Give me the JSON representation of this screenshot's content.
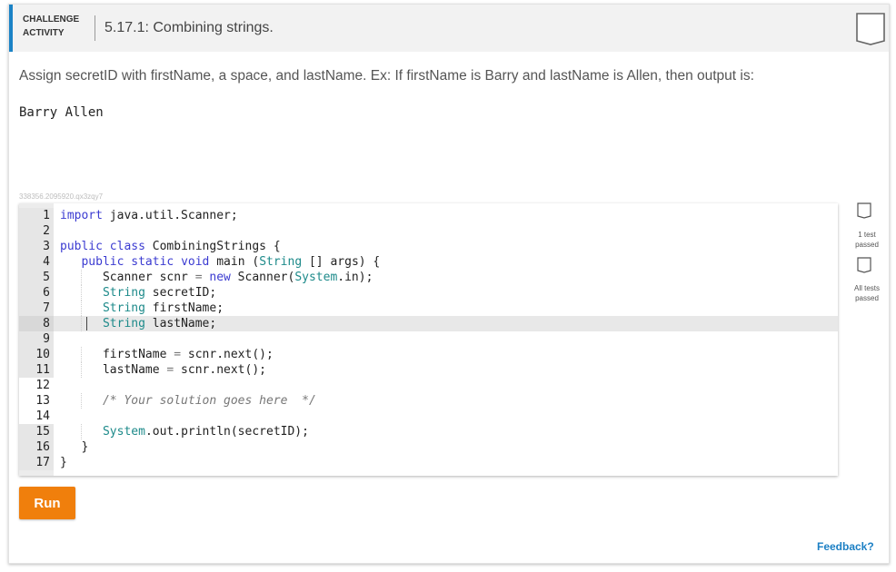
{
  "header": {
    "badge_line1": "CHALLENGE",
    "badge_line2": "ACTIVITY",
    "title": "5.17.1: Combining strings.",
    "accent_color": "#1b83c6"
  },
  "instructions": "Assign secretID with firstName, a space, and lastName. Ex: If firstName is Barry and lastName is Allen, then output is:",
  "example_output": "Barry Allen",
  "activity_id": "338356.2095920.qx3zqy7",
  "code": {
    "active_line": 8,
    "lines": [
      {
        "n": "1",
        "text": "import java.util.Scanner;"
      },
      {
        "n": "2",
        "text": ""
      },
      {
        "n": "3",
        "text": "public class CombiningStrings {"
      },
      {
        "n": "4",
        "text": "   public static void main (String [] args) {"
      },
      {
        "n": "5",
        "text": "      Scanner scnr = new Scanner(System.in);"
      },
      {
        "n": "6",
        "text": "      String secretID;"
      },
      {
        "n": "7",
        "text": "      String firstName;"
      },
      {
        "n": "8",
        "text": "      String lastName;"
      },
      {
        "n": "9",
        "text": ""
      },
      {
        "n": "10",
        "text": "      firstName = scnr.next();"
      },
      {
        "n": "11",
        "text": "      lastName = scnr.next();"
      },
      {
        "n": "12",
        "text": ""
      },
      {
        "n": "13",
        "text": "      /* Your solution goes here  */"
      },
      {
        "n": "14",
        "text": ""
      },
      {
        "n": "15",
        "text": "      System.out.println(secretID);"
      },
      {
        "n": "16",
        "text": "   }"
      },
      {
        "n": "17",
        "text": "}"
      }
    ]
  },
  "tests": {
    "test1_label": "1 test passed",
    "test2_label": "All tests passed",
    "icon": "bookmark-checkbox-icon"
  },
  "run_label": "Run",
  "run_color": "#f07f0c",
  "feedback_label": "Feedback?",
  "link_color": "#1b7fc4"
}
